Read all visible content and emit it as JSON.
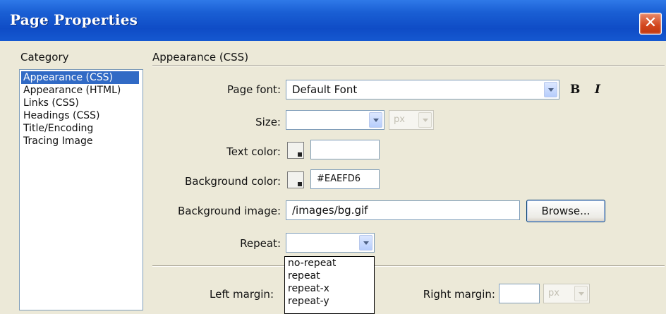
{
  "window": {
    "title": "Page Properties",
    "close_glyph": "✕"
  },
  "category": {
    "label": "Category",
    "items": [
      {
        "label": "Appearance (CSS)",
        "selected": true
      },
      {
        "label": "Appearance (HTML)"
      },
      {
        "label": "Links (CSS)"
      },
      {
        "label": "Headings (CSS)"
      },
      {
        "label": "Title/Encoding"
      },
      {
        "label": "Tracing Image"
      }
    ]
  },
  "section": {
    "title": "Appearance (CSS)"
  },
  "form": {
    "page_font_label": "Page font:",
    "page_font_value": "Default Font",
    "bold_label": "B",
    "italic_label": "I",
    "size_label": "Size:",
    "size_value": "",
    "size_unit_value": "px",
    "text_color_label": "Text color:",
    "text_color_value": "",
    "bg_color_label": "Background color:",
    "bg_color_value": "#EAEFD6",
    "bg_image_label": "Background image:",
    "bg_image_value": "/images/bg.gif",
    "browse_label": "Browse...",
    "repeat_label": "Repeat:",
    "repeat_value": "",
    "repeat_options": [
      "no-repeat",
      "repeat",
      "repeat-x",
      "repeat-y"
    ],
    "left_margin_label": "Left margin:",
    "right_margin_label": "Right margin:",
    "right_margin_value": "",
    "right_margin_unit": "px"
  },
  "colors": {
    "titlebar": "#0f4cc6",
    "selection": "#316ac5",
    "dialog_bg": "#ece9d8"
  }
}
